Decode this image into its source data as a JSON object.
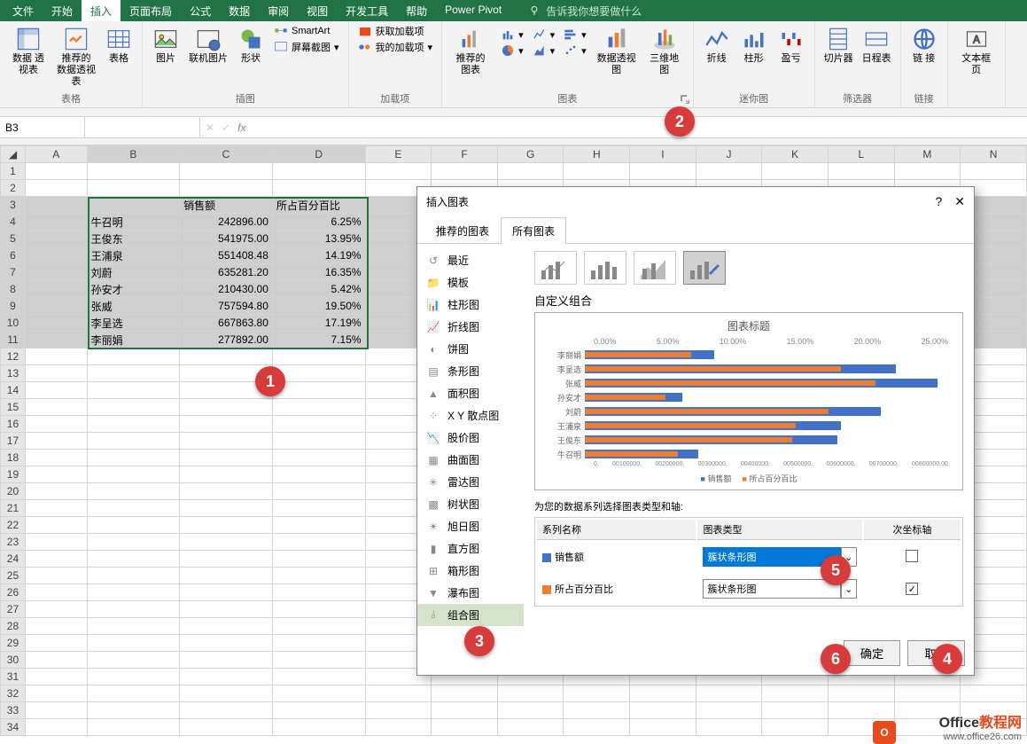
{
  "ribbon": {
    "tabs": [
      "文件",
      "开始",
      "插入",
      "页面布局",
      "公式",
      "数据",
      "审阅",
      "视图",
      "开发工具",
      "帮助",
      "Power Pivot"
    ],
    "active_tab": "插入",
    "tellme": "告诉我你想要做什么",
    "groups": {
      "tables": {
        "label": "表格",
        "pivot": "数据\n透视表",
        "rec_pivot": "推荐的\n数据透视表",
        "table": "表格"
      },
      "illustrations": {
        "label": "插图",
        "picture": "图片",
        "online_pic": "联机图片",
        "shapes": "形状",
        "smartart": "SmartArt",
        "screenshot": "屏幕截图"
      },
      "addins": {
        "label": "加载项",
        "get": "获取加载项",
        "my": "我的加载项"
      },
      "charts": {
        "label": "图表",
        "rec": "推荐的\n图表",
        "pivotchart": "数据透视图",
        "map3d": "三维地\n图"
      },
      "sparklines": {
        "label": "迷你图",
        "line": "折线",
        "column": "柱形",
        "winloss": "盈亏"
      },
      "filters": {
        "label": "筛选器",
        "slicer": "切片器",
        "timeline": "日程表"
      },
      "links": {
        "label": "链接",
        "link": "链\n接"
      },
      "text": {
        "label": "",
        "textbox": "文本框 页"
      }
    }
  },
  "namebox": "B3",
  "grid": {
    "cols": [
      "A",
      "B",
      "C",
      "D",
      "E",
      "F",
      "G",
      "H",
      "I",
      "J",
      "K",
      "L",
      "M",
      "N"
    ],
    "headers": {
      "c": "销售额",
      "d": "所占百分百比"
    },
    "rows": [
      {
        "b": "牛召明",
        "c": "242896.00",
        "d": "6.25%"
      },
      {
        "b": "王俊东",
        "c": "541975.00",
        "d": "13.95%"
      },
      {
        "b": "王浦泉",
        "c": "551408.48",
        "d": "14.19%"
      },
      {
        "b": "刘蔚",
        "c": "635281.20",
        "d": "16.35%"
      },
      {
        "b": "孙安才",
        "c": "210430.00",
        "d": "5.42%"
      },
      {
        "b": "张威",
        "c": "757594.80",
        "d": "19.50%"
      },
      {
        "b": "李呈选",
        "c": "667863.80",
        "d": "17.19%"
      },
      {
        "b": "李丽娟",
        "c": "277892.00",
        "d": "7.15%"
      }
    ]
  },
  "dialog": {
    "title": "插入图表",
    "tabs": {
      "rec": "推荐的图表",
      "all": "所有图表"
    },
    "left": [
      "最近",
      "模板",
      "柱形图",
      "折线图",
      "饼图",
      "条形图",
      "面积图",
      "X Y 散点图",
      "股价图",
      "曲面图",
      "雷达图",
      "树状图",
      "旭日图",
      "直方图",
      "箱形图",
      "瀑布图",
      "组合图"
    ],
    "active_left": "组合图",
    "subtitle": "自定义组合",
    "chart_title": "图表标题",
    "series_hint": "为您的数据系列选择图表类型和轴:",
    "th_name": "系列名称",
    "th_type": "图表类型",
    "th_axis": "次坐标轴",
    "series1_name": "销售额",
    "series1_type": "簇状条形图",
    "series2_name": "所占百分百比",
    "series2_type": "簇状条形图",
    "legend1": "销售额",
    "legend2": "所占百分百比",
    "ok": "确定",
    "cancel": "取消",
    "top_ticks": [
      "0.00%",
      "5.00%",
      "10.00%",
      "15.00%",
      "20.00%",
      "25.00%"
    ]
  },
  "chart_data": {
    "type": "bar",
    "categories": [
      "李丽娟",
      "李呈选",
      "张威",
      "孙安才",
      "刘蔚",
      "王浦泉",
      "王俊东",
      "牛召明"
    ],
    "series": [
      {
        "name": "销售额",
        "values": [
          277892.0,
          667863.8,
          757594.8,
          210430.0,
          635281.2,
          551408.48,
          541975.0,
          242896.0
        ]
      },
      {
        "name": "所占百分百比",
        "values": [
          7.15,
          17.19,
          19.5,
          5.42,
          16.35,
          14.19,
          13.95,
          6.25
        ]
      }
    ],
    "title": "图表标题",
    "secondary_axis_top_pct": [
      0,
      5,
      10,
      15,
      20,
      25
    ],
    "primary_axis_bottom_values": [
      0,
      100000,
      200000,
      300000,
      400000,
      500000,
      600000,
      700000,
      800000
    ]
  },
  "badges": {
    "b1": "1",
    "b2": "2",
    "b3": "3",
    "b4": "4",
    "b5": "5",
    "b6": "6"
  },
  "watermark": {
    "t1": "Office",
    "t2": "教程网",
    "sub": "www.office26.com"
  }
}
